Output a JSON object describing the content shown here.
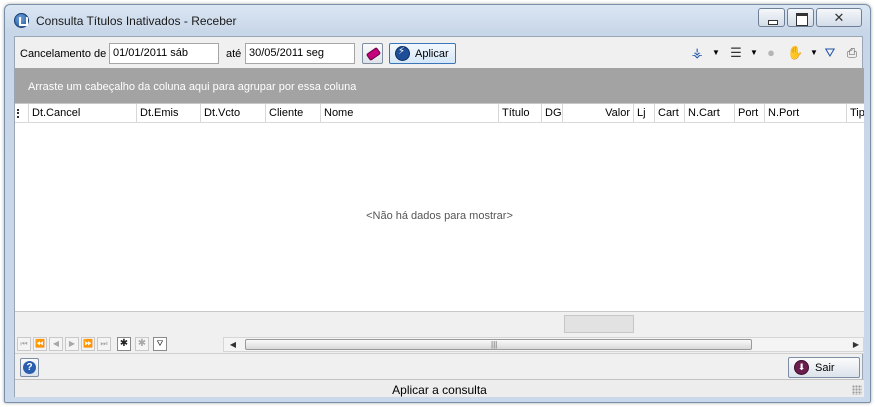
{
  "window": {
    "title": "Consulta Títulos Inativados - Receber",
    "close_glyph": "✕"
  },
  "filter": {
    "label_from": "Cancelamento de",
    "date_from": "01/01/2011 sáb",
    "label_to": "até",
    "date_to": "30/05/2011 seg",
    "apply_label": "Aplicar"
  },
  "toolbar": {
    "icons": [
      "hierarchy-icon",
      "list-options-icon",
      "record-icon",
      "hand-icon",
      "filter-icon",
      "print-icon"
    ]
  },
  "grid": {
    "group_hint": "Arraste um cabeçalho da coluna aqui para agrupar por essa coluna",
    "columns": [
      "Dt.Cancel",
      "Dt.Emis",
      "Dt.Vcto",
      "Cliente",
      "Nome",
      "Título",
      "DG",
      "Valor",
      "Lj",
      "Cart",
      "N.Cart",
      "Port",
      "N.Port",
      "Tipo"
    ],
    "empty_message": "<Não há dados para mostrar>"
  },
  "navigator": {
    "buttons": [
      "first",
      "prev-page",
      "prev",
      "next",
      "next-page",
      "last",
      "insert",
      "delete",
      "filter"
    ]
  },
  "actions": {
    "exit_label": "Sair"
  },
  "status": {
    "text": "Aplicar a consulta"
  },
  "colors": {
    "group_panel": "#a3a3a3",
    "accent": "#1e4e97"
  }
}
